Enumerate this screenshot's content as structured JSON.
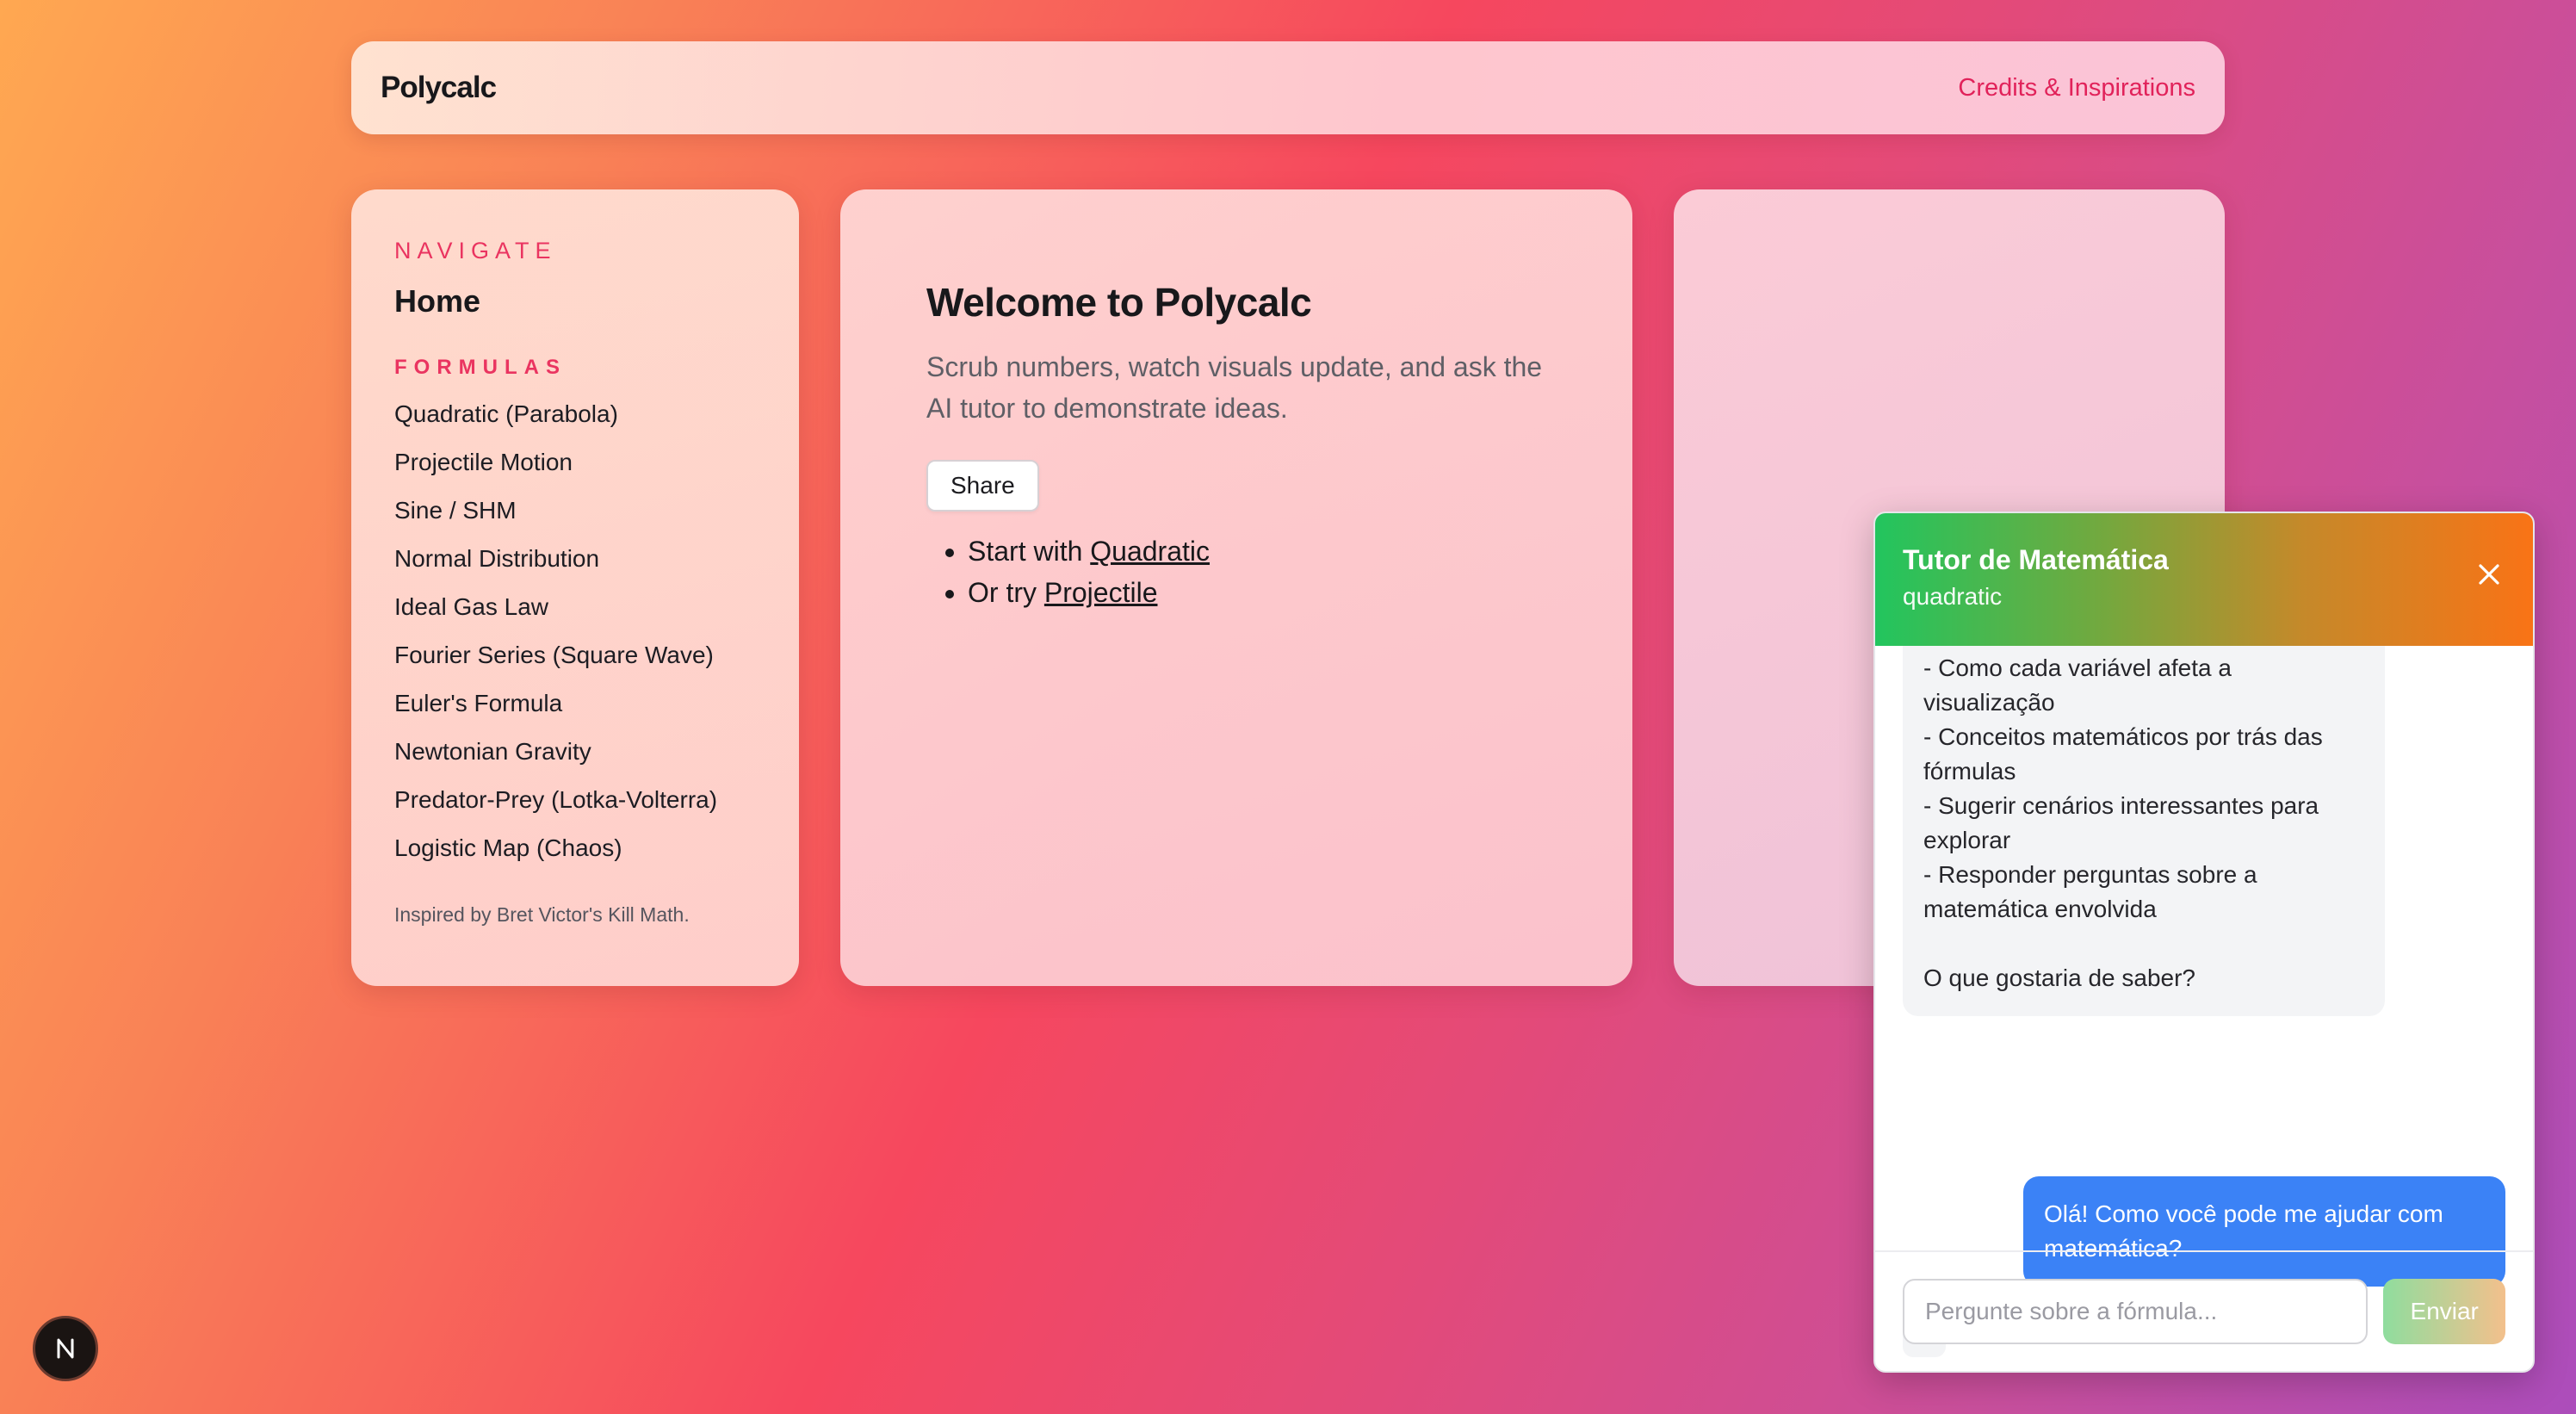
{
  "header": {
    "brand": "Polycalc",
    "credits_link": "Credits & Inspirations"
  },
  "sidebar": {
    "navigate_label": "NAVIGATE",
    "home": "Home",
    "formulas_label": "FORMULAS",
    "formulas": [
      "Quadratic (Parabola)",
      "Projectile Motion",
      "Sine / SHM",
      "Normal Distribution",
      "Ideal Gas Law",
      "Fourier Series (Square Wave)",
      "Euler's Formula",
      "Newtonian Gravity",
      "Predator-Prey (Lotka-Volterra)",
      "Logistic Map (Chaos)"
    ],
    "footer": "Inspired by Bret Victor's Kill Math."
  },
  "main": {
    "title": "Welcome to Polycalc",
    "subtitle": "Scrub numbers, watch visuals update, and ask the AI tutor to demonstrate ideas.",
    "share_label": "Share",
    "start_prefix": "Start with",
    "start_link": "Quadratic",
    "try_prefix": "Or try",
    "try_link": "Projectile"
  },
  "chat": {
    "title": "Tutor de Matemática",
    "subtitle": "quadratic",
    "bot_message": "- Como cada variável afeta a\nvisualização\n- Conceitos matemáticos por trás das\nfórmulas\n- Sugerir cenários interessantes para\nexplorar\n- Responder perguntas sobre a\nmatemática envolvida\n\nO que gostaria de saber?",
    "user_message": "Olá! Como você pode me ajudar com matemática?",
    "input_placeholder": "Pergunte sobre a fórmula...",
    "send_label": "Enviar"
  },
  "badge": {
    "letter": "N"
  },
  "colors": {
    "accent": "#ea3460",
    "user_bubble": "#3b82f6"
  }
}
